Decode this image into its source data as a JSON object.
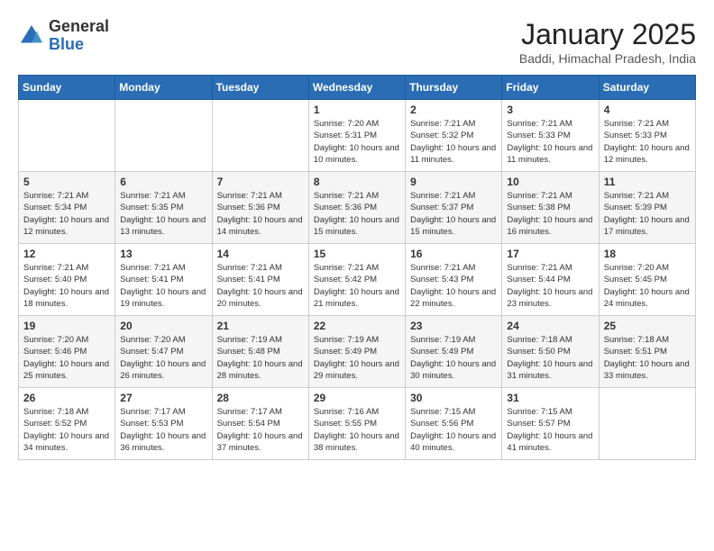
{
  "header": {
    "logo_general": "General",
    "logo_blue": "Blue",
    "title": "January 2025",
    "subtitle": "Baddi, Himachal Pradesh, India"
  },
  "days_of_week": [
    "Sunday",
    "Monday",
    "Tuesday",
    "Wednesday",
    "Thursday",
    "Friday",
    "Saturday"
  ],
  "weeks": [
    [
      {
        "day": "",
        "info": ""
      },
      {
        "day": "",
        "info": ""
      },
      {
        "day": "",
        "info": ""
      },
      {
        "day": "1",
        "info": "Sunrise: 7:20 AM\nSunset: 5:31 PM\nDaylight: 10 hours\nand 10 minutes."
      },
      {
        "day": "2",
        "info": "Sunrise: 7:21 AM\nSunset: 5:32 PM\nDaylight: 10 hours\nand 11 minutes."
      },
      {
        "day": "3",
        "info": "Sunrise: 7:21 AM\nSunset: 5:33 PM\nDaylight: 10 hours\nand 11 minutes."
      },
      {
        "day": "4",
        "info": "Sunrise: 7:21 AM\nSunset: 5:33 PM\nDaylight: 10 hours\nand 12 minutes."
      }
    ],
    [
      {
        "day": "5",
        "info": "Sunrise: 7:21 AM\nSunset: 5:34 PM\nDaylight: 10 hours\nand 12 minutes."
      },
      {
        "day": "6",
        "info": "Sunrise: 7:21 AM\nSunset: 5:35 PM\nDaylight: 10 hours\nand 13 minutes."
      },
      {
        "day": "7",
        "info": "Sunrise: 7:21 AM\nSunset: 5:36 PM\nDaylight: 10 hours\nand 14 minutes."
      },
      {
        "day": "8",
        "info": "Sunrise: 7:21 AM\nSunset: 5:36 PM\nDaylight: 10 hours\nand 15 minutes."
      },
      {
        "day": "9",
        "info": "Sunrise: 7:21 AM\nSunset: 5:37 PM\nDaylight: 10 hours\nand 15 minutes."
      },
      {
        "day": "10",
        "info": "Sunrise: 7:21 AM\nSunset: 5:38 PM\nDaylight: 10 hours\nand 16 minutes."
      },
      {
        "day": "11",
        "info": "Sunrise: 7:21 AM\nSunset: 5:39 PM\nDaylight: 10 hours\nand 17 minutes."
      }
    ],
    [
      {
        "day": "12",
        "info": "Sunrise: 7:21 AM\nSunset: 5:40 PM\nDaylight: 10 hours\nand 18 minutes."
      },
      {
        "day": "13",
        "info": "Sunrise: 7:21 AM\nSunset: 5:41 PM\nDaylight: 10 hours\nand 19 minutes."
      },
      {
        "day": "14",
        "info": "Sunrise: 7:21 AM\nSunset: 5:41 PM\nDaylight: 10 hours\nand 20 minutes."
      },
      {
        "day": "15",
        "info": "Sunrise: 7:21 AM\nSunset: 5:42 PM\nDaylight: 10 hours\nand 21 minutes."
      },
      {
        "day": "16",
        "info": "Sunrise: 7:21 AM\nSunset: 5:43 PM\nDaylight: 10 hours\nand 22 minutes."
      },
      {
        "day": "17",
        "info": "Sunrise: 7:21 AM\nSunset: 5:44 PM\nDaylight: 10 hours\nand 23 minutes."
      },
      {
        "day": "18",
        "info": "Sunrise: 7:20 AM\nSunset: 5:45 PM\nDaylight: 10 hours\nand 24 minutes."
      }
    ],
    [
      {
        "day": "19",
        "info": "Sunrise: 7:20 AM\nSunset: 5:46 PM\nDaylight: 10 hours\nand 25 minutes."
      },
      {
        "day": "20",
        "info": "Sunrise: 7:20 AM\nSunset: 5:47 PM\nDaylight: 10 hours\nand 26 minutes."
      },
      {
        "day": "21",
        "info": "Sunrise: 7:19 AM\nSunset: 5:48 PM\nDaylight: 10 hours\nand 28 minutes."
      },
      {
        "day": "22",
        "info": "Sunrise: 7:19 AM\nSunset: 5:49 PM\nDaylight: 10 hours\nand 29 minutes."
      },
      {
        "day": "23",
        "info": "Sunrise: 7:19 AM\nSunset: 5:49 PM\nDaylight: 10 hours\nand 30 minutes."
      },
      {
        "day": "24",
        "info": "Sunrise: 7:18 AM\nSunset: 5:50 PM\nDaylight: 10 hours\nand 31 minutes."
      },
      {
        "day": "25",
        "info": "Sunrise: 7:18 AM\nSunset: 5:51 PM\nDaylight: 10 hours\nand 33 minutes."
      }
    ],
    [
      {
        "day": "26",
        "info": "Sunrise: 7:18 AM\nSunset: 5:52 PM\nDaylight: 10 hours\nand 34 minutes."
      },
      {
        "day": "27",
        "info": "Sunrise: 7:17 AM\nSunset: 5:53 PM\nDaylight: 10 hours\nand 36 minutes."
      },
      {
        "day": "28",
        "info": "Sunrise: 7:17 AM\nSunset: 5:54 PM\nDaylight: 10 hours\nand 37 minutes."
      },
      {
        "day": "29",
        "info": "Sunrise: 7:16 AM\nSunset: 5:55 PM\nDaylight: 10 hours\nand 38 minutes."
      },
      {
        "day": "30",
        "info": "Sunrise: 7:15 AM\nSunset: 5:56 PM\nDaylight: 10 hours\nand 40 minutes."
      },
      {
        "day": "31",
        "info": "Sunrise: 7:15 AM\nSunset: 5:57 PM\nDaylight: 10 hours\nand 41 minutes."
      },
      {
        "day": "",
        "info": ""
      }
    ]
  ]
}
